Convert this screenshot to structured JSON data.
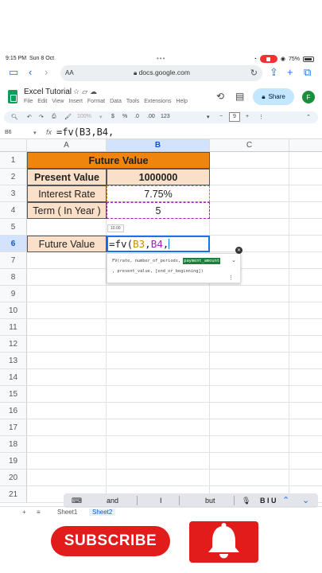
{
  "status": {
    "time": "9:15 PM",
    "date": "Sun 8 Oct",
    "battery": "75%"
  },
  "browser": {
    "aa": "AA",
    "url": "docs.google.com"
  },
  "doc": {
    "title": "Excel Tutorial",
    "menus": [
      "File",
      "Edit",
      "View",
      "Insert",
      "Format",
      "Data",
      "Tools",
      "Extensions",
      "Help"
    ],
    "share_label": "Share",
    "avatar": "F"
  },
  "toolbar": {
    "zoom": "100%",
    "dollar": "$",
    "percent": "%",
    "dec_minus": ".0",
    "dec_plus": ".00",
    "format123": "123",
    "font_minus": "−",
    "font_size": "9",
    "font_plus": "+"
  },
  "formula_bar": {
    "cell_ref": "B6",
    "fx": "fx",
    "formula": "=fv(B3,B4,"
  },
  "columns": [
    "A",
    "B",
    "C"
  ],
  "rows": [
    "1",
    "2",
    "3",
    "4",
    "5",
    "6",
    "7",
    "8",
    "9",
    "10",
    "11",
    "12",
    "13",
    "14",
    "15",
    "16",
    "17",
    "18",
    "19",
    "20",
    "21"
  ],
  "cells": {
    "b1": "Future Value",
    "a2": "Present Value",
    "b2": "1000000",
    "a3": "Interest Rate",
    "b3": "7.75%",
    "a4": "Term ( In Year )",
    "b4": "5",
    "a6": "Future Value",
    "b6_prefix": "=fv(",
    "b6_ref1": "B3",
    "b6_comma1": ",",
    "b6_ref2": "B4",
    "b6_comma2": ","
  },
  "hint": "10.00",
  "formula_help": {
    "line1_prefix": "FV(rate, number_of_periods, ",
    "highlight": "payment_amount",
    "line2": ", present_value, [end_or_beginning])"
  },
  "keyboard": {
    "s1": "and",
    "s2": "I",
    "s3": "but",
    "fmt": "B I U"
  },
  "sheets": {
    "add": "+",
    "menu": "≡",
    "tab1": "Sheet1",
    "tab2": "Sheet2"
  },
  "subscribe": "SUBSCRIBE",
  "colors": {
    "header_orange": "#f0850d",
    "label_peach": "#fbe0c9",
    "accent_blue": "#1a73e8",
    "subscribe_red": "#e21b1b",
    "ref_b3": "#c58c0a",
    "ref_b4": "#9c27b0"
  }
}
